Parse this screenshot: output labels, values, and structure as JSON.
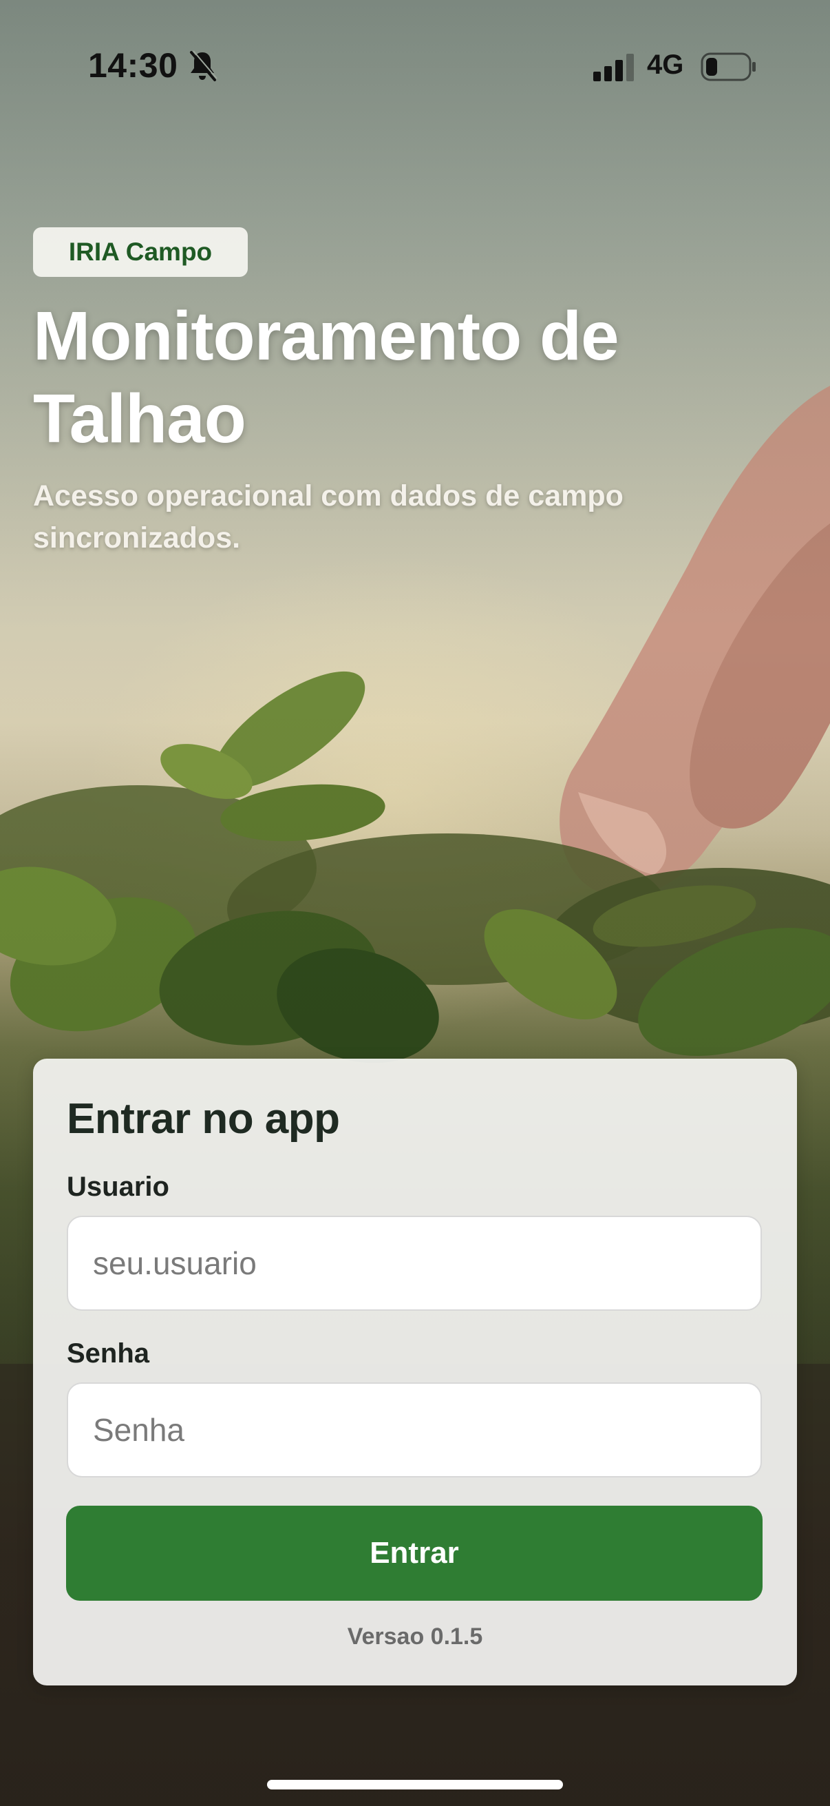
{
  "status_bar": {
    "time": "14:30",
    "network": "4G",
    "icons": [
      "bell-slash-icon",
      "signal-bars-icon",
      "battery-low-icon"
    ]
  },
  "hero": {
    "brand": "IRIA Campo",
    "title": "Monitoramento de Talhao",
    "subtitle": "Acesso operacional com dados de campo sincronizados."
  },
  "login": {
    "title": "Entrar no app",
    "username": {
      "label": "Usuario",
      "placeholder": "seu.usuario",
      "value": ""
    },
    "password": {
      "label": "Senha",
      "placeholder": "Senha",
      "value": ""
    },
    "submit_label": "Entrar",
    "version": "Versao 0.1.5"
  },
  "colors": {
    "primary": "#2f7d33",
    "brand_text": "#1f5a24",
    "card_background": "#f4f4f2"
  }
}
